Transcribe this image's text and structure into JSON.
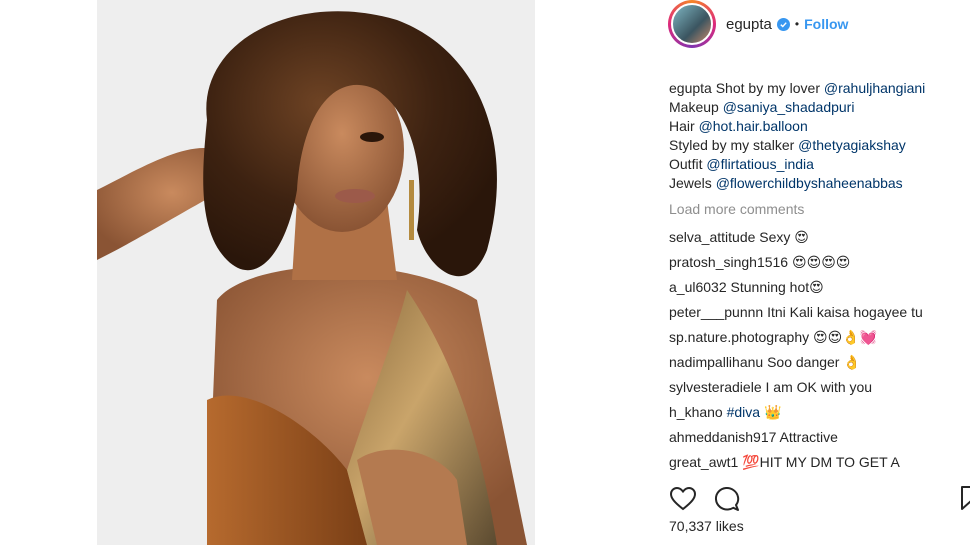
{
  "post": {
    "username": "egupta",
    "follow_label": "Follow",
    "separator": "•",
    "likes": "70,337 likes"
  },
  "caption": {
    "user": "egupta",
    "lines": [
      {
        "prefix": "Shot by my lover ",
        "mention": "@rahuljhangiani"
      },
      {
        "prefix": "Makeup ",
        "mention": "@saniya_shadadpuri"
      },
      {
        "prefix": "Hair ",
        "mention": "@hot.hair.balloon"
      },
      {
        "prefix": "Styled by my stalker ",
        "mention": "@thetyagiakshay"
      },
      {
        "prefix": "Outfit ",
        "mention": "@flirtatious_india"
      },
      {
        "prefix": "Jewels ",
        "mention": "@flowerchildbyshaheenabbas"
      }
    ]
  },
  "load_more": "Load more comments",
  "comments": [
    {
      "user": "selva_attitude",
      "text": "Sexy 😍"
    },
    {
      "user": "pratosh_singh1516",
      "text": "😍😍😍😍"
    },
    {
      "user": "a_ul6032",
      "text": "Stunning hot😍"
    },
    {
      "user": "peter___punnn",
      "text": "Itni Kali kaisa hogayee tu"
    },
    {
      "user": "sp.nature.photography",
      "text": "😍😍👌💓"
    },
    {
      "user": "nadimpallihanu",
      "text": "Soo danger 👌"
    },
    {
      "user": "sylvesteradiele",
      "text": "I am OK with you"
    },
    {
      "user": "h_khano",
      "text": "",
      "tag": "#diva",
      "suffix": " 👑"
    },
    {
      "user": "ahmeddanish917",
      "text": "Attractive"
    },
    {
      "user": "great_awt1",
      "text": "💯HIT MY DM TO GET A"
    }
  ],
  "icons": {
    "like": "heart-icon",
    "comment": "comment-icon",
    "save": "bookmark-icon",
    "verified": "verified-badge-icon"
  },
  "colors": {
    "link": "#003569",
    "follow": "#3897f0",
    "muted": "#8e8e8e"
  }
}
